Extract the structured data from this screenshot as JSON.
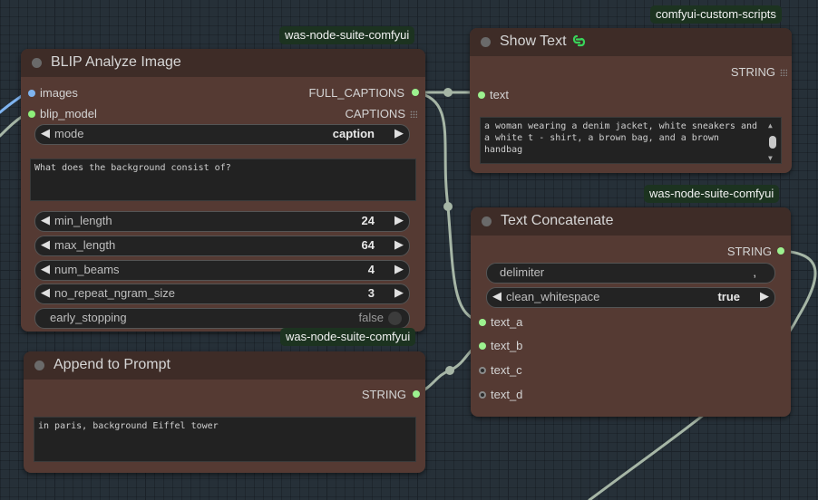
{
  "colors": {
    "image_slot": "#7fb4f0",
    "model_slot": "#8ef07a",
    "string_slot": "#9cf28f",
    "link": "#a6b6a6",
    "node_body": "#553a33",
    "node_header": "#3e2c27",
    "badge_bg": "#1c3320"
  },
  "blip": {
    "title": "BLIP Analyze Image",
    "badge": "was-node-suite-comfyui",
    "inputs": [
      "images",
      "blip_model"
    ],
    "outputs": [
      "FULL_CAPTIONS",
      "CAPTIONS"
    ],
    "mode": {
      "name": "mode",
      "value": "caption"
    },
    "question": "What does the background consist of?",
    "min_length": {
      "name": "min_length",
      "value": "24"
    },
    "max_length": {
      "name": "max_length",
      "value": "64"
    },
    "num_beams": {
      "name": "num_beams",
      "value": "4"
    },
    "no_repeat": {
      "name": "no_repeat_ngram_size",
      "value": "3"
    },
    "early_stopping": {
      "name": "early_stopping",
      "value": "false"
    }
  },
  "show_text": {
    "title": "Show Text",
    "icon": "link-icon",
    "badge": "comfyui-custom-scripts",
    "output": "STRING",
    "input": "text",
    "content": "a woman wearing a denim jacket, white sneakers and a white t - shirt, a brown bag, and a brown handbag"
  },
  "concat": {
    "title": "Text Concatenate",
    "badge": "was-node-suite-comfyui",
    "output": "STRING",
    "delimiter": {
      "name": "delimiter",
      "value": ","
    },
    "clean_whitespace": {
      "name": "clean_whitespace",
      "value": "true"
    },
    "inputs": [
      "text_a",
      "text_b",
      "text_c",
      "text_d"
    ]
  },
  "append": {
    "title": "Append to Prompt",
    "badge": "was-node-suite-comfyui",
    "output": "STRING",
    "content": "in paris, background Eiffel tower"
  }
}
